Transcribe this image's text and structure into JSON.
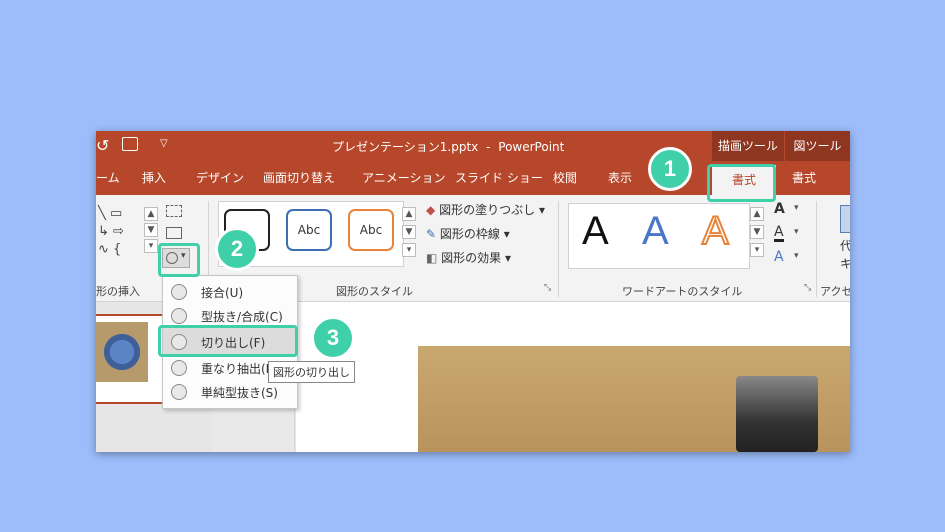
{
  "title": {
    "document": "プレゼンテーション1.pptx",
    "separator": "-",
    "app": "PowerPoint",
    "ctx_drawing": "描画ツール",
    "ctx_picture": "図ツール",
    "undo_icon": "undo-icon",
    "present_icon": "present-from-start-icon",
    "qat_icon": "customize-qat-icon"
  },
  "tabs": [
    "ーム",
    "挿入",
    "デザイン",
    "画面切り替え",
    "アニメーション",
    "スライド ショー",
    "校閲",
    "表示"
  ],
  "context_tabs": {
    "drawing_format": "書式",
    "picture_format": "書式"
  },
  "ribbon": {
    "groups": {
      "insert_shapes": "形の挿入",
      "shape_styles": "図形のスタイル",
      "wordart_styles": "ワードアートのスタイル",
      "accessibility": "アクセ"
    },
    "style_thumbs": [
      "Abc",
      "Abc",
      "Abc"
    ],
    "shape_fill": "図形の塗りつぶし",
    "shape_outline": "図形の枠線",
    "shape_effects": "図形の効果",
    "wordart": [
      "A",
      "A",
      "A"
    ],
    "text_fill_icon": "A",
    "text_outline_icon": "A",
    "text_effect_icon": "A",
    "alt_text": "代",
    "alt_text2": "キ",
    "expand_icon": "⤡",
    "dropdown": "▾"
  },
  "merge_menu": {
    "items": [
      "接合(U)",
      "型抜き/合成(C)",
      "切り出し(F)",
      "重なり抽出(I)",
      "単純型抜き(S)"
    ],
    "tooltip": "図形の切り出し"
  },
  "steps": [
    "1",
    "2",
    "3"
  ],
  "colors": {
    "accent": "#b7472a",
    "highlight": "#3fd0aa",
    "background": "#9cbcfa"
  }
}
